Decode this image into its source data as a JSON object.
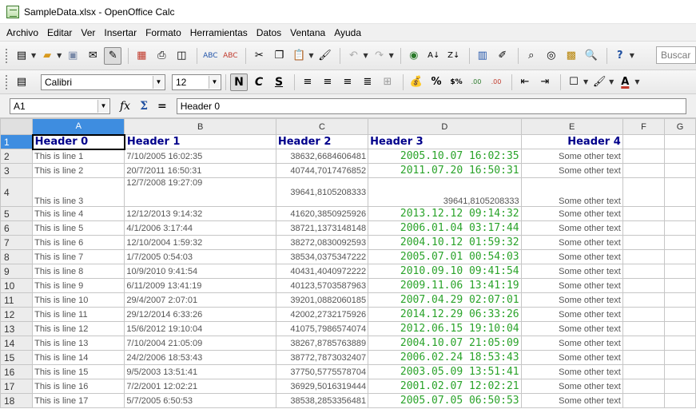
{
  "window": {
    "title": "SampleData.xlsx - OpenOffice Calc"
  },
  "menubar": {
    "items": [
      "Archivo",
      "Editar",
      "Ver",
      "Insertar",
      "Formato",
      "Herramientas",
      "Datos",
      "Ventana",
      "Ayuda"
    ]
  },
  "toolbar": {
    "search_placeholder": "Buscar",
    "font_name": "Calibri",
    "font_size": "12",
    "bold_label": "N",
    "italic_label": "C",
    "underline_label": "S"
  },
  "formula_bar": {
    "name_box": "A1",
    "content": "Header 0"
  },
  "sheet": {
    "column_headers": [
      "A",
      "B",
      "C",
      "D",
      "E",
      "F",
      "G"
    ],
    "header_row": [
      "Header 0",
      "Header 1",
      "Header 2",
      "Header 3",
      "Header 4"
    ],
    "row_numbers": [
      "1",
      "2",
      "3",
      "4",
      "5",
      "6",
      "7",
      "8",
      "9",
      "10",
      "11",
      "12",
      "13",
      "14",
      "15",
      "16",
      "17",
      "18"
    ],
    "rows": [
      [
        "This is line 1",
        "7/10/2005 16:02:35",
        "38632,6684606481",
        "2005.10.07 16:02:35",
        "Some other text"
      ],
      [
        "This is line 2",
        "20/7/2011 16:50:31",
        "40744,7017476852",
        "2011.07.20 16:50:31",
        "Some other text"
      ],
      [
        "This is line 3",
        "12/7/2008 19:27:09",
        "39641,8105208333",
        "39641,8105208333",
        "Some other text"
      ],
      [
        "This is line 4",
        "12/12/2013 9:14:32",
        "41620,3850925926",
        "2013.12.12 09:14:32",
        "Some other text"
      ],
      [
        "This is line 5",
        "4/1/2006 3:17:44",
        "38721,1373148148",
        "2006.01.04 03:17:44",
        "Some other text"
      ],
      [
        "This is line 6",
        "12/10/2004 1:59:32",
        "38272,0830092593",
        "2004.10.12 01:59:32",
        "Some other text"
      ],
      [
        "This is line 7",
        "1/7/2005 0:54:03",
        "38534,0375347222",
        "2005.07.01 00:54:03",
        "Some other text"
      ],
      [
        "This is line 8",
        "10/9/2010 9:41:54",
        "40431,4040972222",
        "2010.09.10 09:41:54",
        "Some other text"
      ],
      [
        "This is line 9",
        "6/11/2009 13:41:19",
        "40123,5703587963",
        "2009.11.06 13:41:19",
        "Some other text"
      ],
      [
        "This is line 10",
        "29/4/2007 2:07:01",
        "39201,0882060185",
        "2007.04.29 02:07:01",
        "Some other text"
      ],
      [
        "This is line 11",
        "29/12/2014 6:33:26",
        "42002,2732175926",
        "2014.12.29 06:33:26",
        "Some other text"
      ],
      [
        "This is line 12",
        "15/6/2012 19:10:04",
        "41075,7986574074",
        "2012.06.15 19:10:04",
        "Some other text"
      ],
      [
        "This is line 13",
        "7/10/2004 21:05:09",
        "38267,8785763889",
        "2004.10.07 21:05:09",
        "Some other text"
      ],
      [
        "This is line 14",
        "24/2/2006 18:53:43",
        "38772,7873032407",
        "2006.02.24 18:53:43",
        "Some other text"
      ],
      [
        "This is line 15",
        "9/5/2003 13:51:41",
        "37750,5775578704",
        "2003.05.09 13:51:41",
        "Some other text"
      ],
      [
        "This is line 16",
        "7/2/2001 12:02:21",
        "36929,5016319444",
        "2001.02.07 12:02:21",
        "Some other text"
      ],
      [
        "This is line 17",
        "5/7/2005 6:50:53",
        "38538,2853356481",
        "2005.07.05 06:50:53",
        "Some other text"
      ]
    ]
  },
  "colors": {
    "header_text": "#00008b",
    "date_text": "#2aa32a",
    "selection": "#3e8de0"
  }
}
